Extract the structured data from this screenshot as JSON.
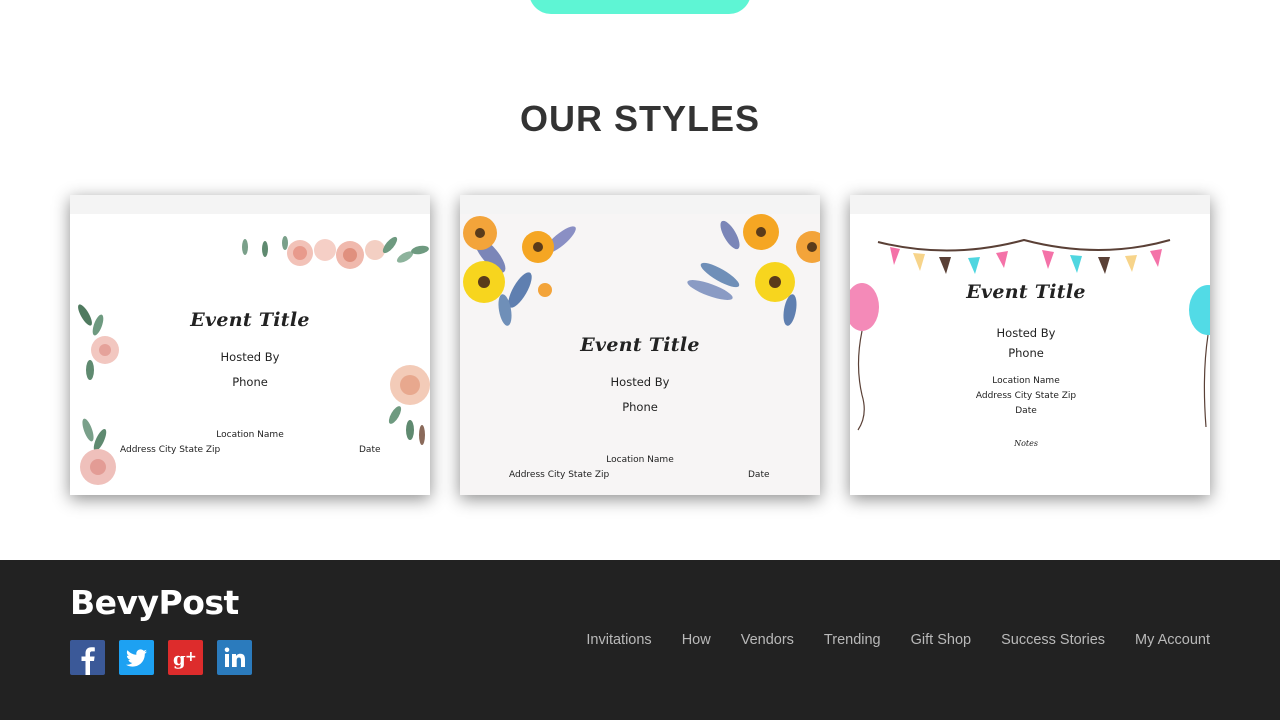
{
  "section_title": "OUR STYLES",
  "cards": [
    {
      "event_title": "Event Title",
      "hosted_by": "Hosted By",
      "phone": "Phone",
      "location": "Location Name",
      "address": "Address  City  State  Zip",
      "date": "Date"
    },
    {
      "event_title": "Event Title",
      "hosted_by": "Hosted By",
      "phone": "Phone",
      "location": "Location Name",
      "address": "Address  City  State  Zip",
      "date": "Date"
    },
    {
      "event_title": "Event Title",
      "hosted_by": "Hosted By",
      "phone": "Phone",
      "location": "Location Name",
      "address": "Address  City  State  Zip",
      "date": "Date",
      "notes": "Notes"
    }
  ],
  "footer": {
    "brand": "BevyPost",
    "social": [
      {
        "name": "facebook-icon",
        "color": "#3b5998"
      },
      {
        "name": "twitter-icon",
        "color": "#1da1f2"
      },
      {
        "name": "google-plus-icon",
        "color": "#dd2c2c"
      },
      {
        "name": "linkedin-icon",
        "color": "#2b7bbd"
      }
    ],
    "nav": [
      "Invitations",
      "How",
      "Vendors",
      "Trending",
      "Gift Shop",
      "Success Stories",
      "My Account"
    ]
  },
  "colors": {
    "accent_button": "#5ef5d4",
    "footer_bg": "#222222",
    "footer_link": "#b9b9b9",
    "title_text": "#333333"
  }
}
